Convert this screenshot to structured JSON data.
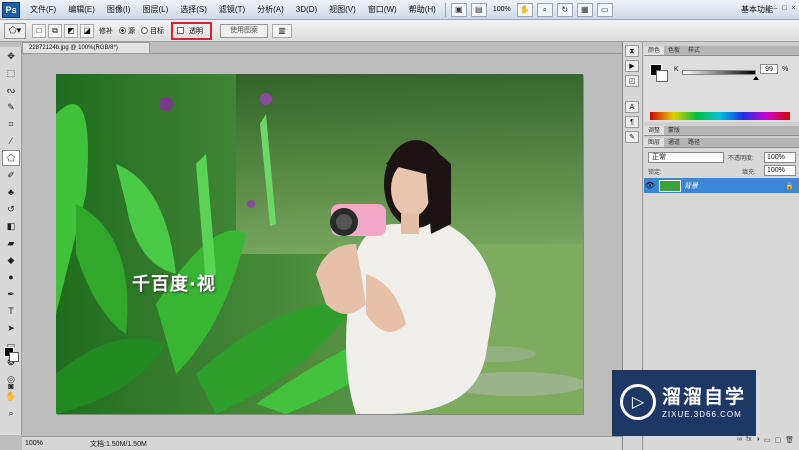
{
  "menubar": {
    "app_logo": "Ps",
    "menus": [
      "文件(F)",
      "编辑(E)",
      "图像(I)",
      "图层(L)",
      "选择(S)",
      "滤镜(T)",
      "分析(A)",
      "3D(D)",
      "视图(V)",
      "窗口(W)",
      "帮助(H)"
    ],
    "zoom": "100%",
    "workspace": "基本功能"
  },
  "options": {
    "feather_label": "修补",
    "source_label": "源",
    "target_label": "目标",
    "transparent_label": "透明",
    "use_pattern": "使用图案"
  },
  "document": {
    "tab_title": "22872124b.jpg @ 100%(RGB/8*)",
    "status_zoom": "100%",
    "status_doc": "文档:1.50M/1.50M",
    "canvas_overlay_text": "千百度·视"
  },
  "color_panel": {
    "tabs": [
      "颜色",
      "色板",
      "样式"
    ],
    "k_label": "K",
    "k_value": "99",
    "k_unit": "%",
    "k_fraction": 0.99
  },
  "adjust_panel": {
    "tabs": [
      "调整",
      "蒙版"
    ]
  },
  "layers_panel": {
    "tabs": [
      "图层",
      "通道",
      "路径"
    ],
    "blend_mode": "正常",
    "opacity_label": "不透明度:",
    "opacity_value": "100%",
    "lock_label": "锁定:",
    "fill_label": "填充:",
    "fill_value": "100%",
    "layer_name": "背景"
  },
  "watermark": {
    "title": "溜溜自学",
    "url": "ZIXUE.3D66.COM"
  },
  "colors": {
    "accent": "#3a86d8",
    "highlight": "#d9232d",
    "watermark_bg": "#1e3866"
  }
}
